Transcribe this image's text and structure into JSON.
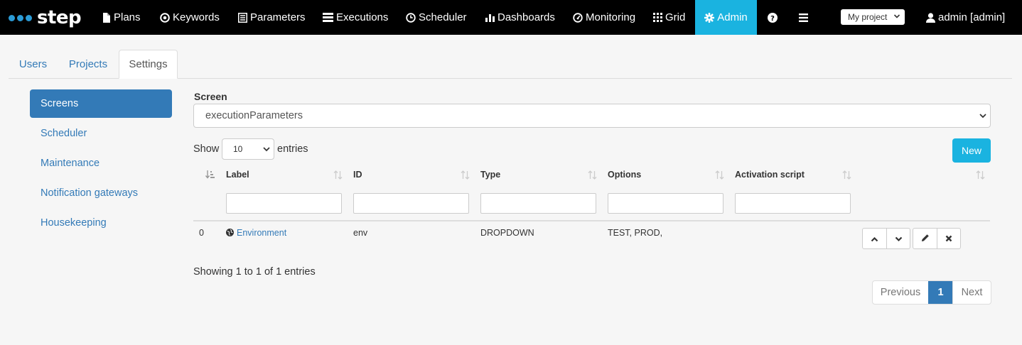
{
  "app": {
    "logo_text": "step"
  },
  "nav": {
    "items": [
      {
        "label": "Plans",
        "icon": "file-icon"
      },
      {
        "label": "Keywords",
        "icon": "target-icon"
      },
      {
        "label": "Parameters",
        "icon": "list-icon"
      },
      {
        "label": "Executions",
        "icon": "tasks-icon"
      },
      {
        "label": "Scheduler",
        "icon": "clock-icon"
      },
      {
        "label": "Dashboards",
        "icon": "bar-chart-icon"
      },
      {
        "label": "Monitoring",
        "icon": "dashboard-icon"
      },
      {
        "label": "Grid",
        "icon": "grid-icon"
      },
      {
        "label": "Admin",
        "icon": "gear-icon"
      }
    ],
    "project_select": "My project",
    "user": "admin [admin]"
  },
  "tabs": [
    {
      "label": "Users"
    },
    {
      "label": "Projects"
    },
    {
      "label": "Settings"
    }
  ],
  "sidebar": {
    "items": [
      {
        "label": "Screens"
      },
      {
        "label": "Scheduler"
      },
      {
        "label": "Maintenance"
      },
      {
        "label": "Notification gateways"
      },
      {
        "label": "Housekeeping"
      }
    ]
  },
  "main": {
    "screen_label": "Screen",
    "screen_value": "executionParameters",
    "show_label": "Show",
    "page_length": "10",
    "entries_label": "entries",
    "new_button": "New",
    "columns": [
      "Label",
      "ID",
      "Type",
      "Options",
      "Activation script"
    ],
    "rows": [
      {
        "index": "0",
        "label": "Environment",
        "id": "env",
        "type": "DROPDOWN",
        "options": "TEST, PROD,",
        "activation_script": ""
      }
    ],
    "info": "Showing 1 to 1 of 1 entries",
    "pagination": {
      "previous": "Previous",
      "current": "1",
      "next": "Next"
    }
  },
  "colors": {
    "navbar": "#000000",
    "accent": "#1ab3e0",
    "primary": "#337ab7",
    "background": "#f6f6f6"
  }
}
